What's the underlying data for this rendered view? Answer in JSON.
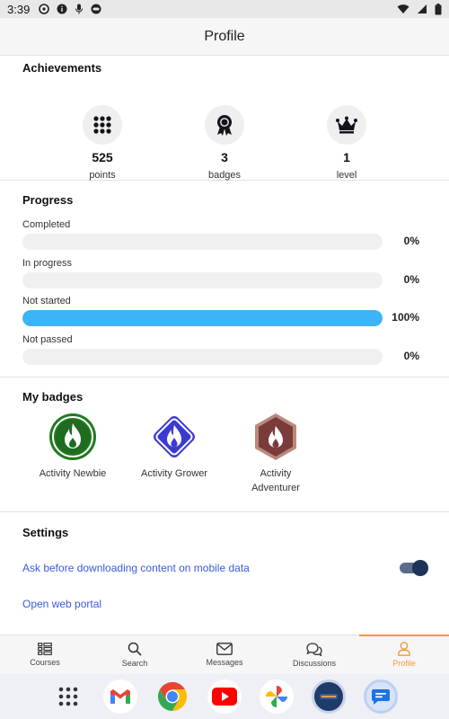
{
  "status": {
    "time": "3:39"
  },
  "header": {
    "title": "Profile"
  },
  "achievements": {
    "heading": "Achievements",
    "items": [
      {
        "value": "525",
        "label": "points",
        "icon": "dots-grid-icon"
      },
      {
        "value": "3",
        "label": "badges",
        "icon": "medal-icon"
      },
      {
        "value": "1",
        "label": "level",
        "icon": "crown-icon"
      }
    ]
  },
  "progress": {
    "heading": "Progress",
    "rows": [
      {
        "label": "Completed",
        "percent": "0%",
        "fraction": 0
      },
      {
        "label": "In progress",
        "percent": "0%",
        "fraction": 0
      },
      {
        "label": "Not started",
        "percent": "100%",
        "fraction": 1
      },
      {
        "label": "Not passed",
        "percent": "0%",
        "fraction": 0
      }
    ]
  },
  "badges": {
    "heading": "My badges",
    "items": [
      {
        "name": "Activity Newbie",
        "color": "#1f7a1f"
      },
      {
        "name": "Activity Grower",
        "color": "#3b3bd1"
      },
      {
        "name": "Activity Adventurer",
        "color": "#7a3b3b"
      }
    ]
  },
  "settings": {
    "heading": "Settings",
    "download_prompt": "Ask before downloading content on mobile data",
    "download_prompt_enabled": true,
    "web_portal": "Open web portal"
  },
  "bottom_nav": {
    "tabs": [
      {
        "label": "Courses",
        "icon": "courses-icon"
      },
      {
        "label": "Search",
        "icon": "search-icon"
      },
      {
        "label": "Messages",
        "icon": "mail-icon"
      },
      {
        "label": "Discussions",
        "icon": "discussions-icon"
      },
      {
        "label": "Profile",
        "icon": "person-icon",
        "active": true
      }
    ]
  },
  "colors": {
    "accent": "#f29a3b",
    "progress_fill": "#3cb4f7",
    "link": "#3a5bd9"
  }
}
